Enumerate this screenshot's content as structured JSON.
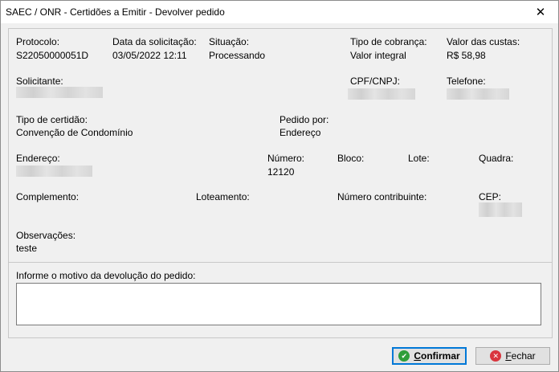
{
  "window": {
    "title": "SAEC / ONR - Certidões a Emitir - Devolver pedido",
    "close_glyph": "✕"
  },
  "fields": {
    "protocolo": {
      "label": "Protocolo:",
      "value": "S22050000051D"
    },
    "data_solicitacao": {
      "label": "Data da solicitação:",
      "value": "03/05/2022 12:11"
    },
    "situacao": {
      "label": "Situação:",
      "value": "Processando"
    },
    "tipo_cobranca": {
      "label": "Tipo de cobrança:",
      "value": "Valor integral"
    },
    "valor_custas": {
      "label": "Valor das custas:",
      "value": "R$ 58,98"
    },
    "solicitante": {
      "label": "Solicitante:"
    },
    "cpf_cnpj": {
      "label": "CPF/CNPJ:"
    },
    "telefone": {
      "label": "Telefone:"
    },
    "tipo_certidao": {
      "label": "Tipo de certidão:",
      "value": "Convenção de Condomínio"
    },
    "pedido_por": {
      "label": "Pedido por:",
      "value": "Endereço"
    },
    "endereco": {
      "label": "Endereço:"
    },
    "numero": {
      "label": "Número:",
      "value": "12120"
    },
    "bloco": {
      "label": "Bloco:"
    },
    "lote": {
      "label": "Lote:"
    },
    "quadra": {
      "label": "Quadra:"
    },
    "complemento": {
      "label": "Complemento:"
    },
    "loteamento": {
      "label": "Loteamento:"
    },
    "numero_contribuinte": {
      "label": "Número contribuinte:"
    },
    "cep": {
      "label": "CEP:"
    },
    "observacoes": {
      "label": "Observações:",
      "value": "teste"
    }
  },
  "motivo": {
    "label": "Informe o motivo da devolução do pedido:",
    "value": ""
  },
  "buttons": {
    "confirmar": {
      "accel": "C",
      "rest": "onfirmar",
      "icon": "check-circle-icon"
    },
    "fechar": {
      "accel": "F",
      "rest": "echar",
      "icon": "close-circle-icon"
    }
  }
}
